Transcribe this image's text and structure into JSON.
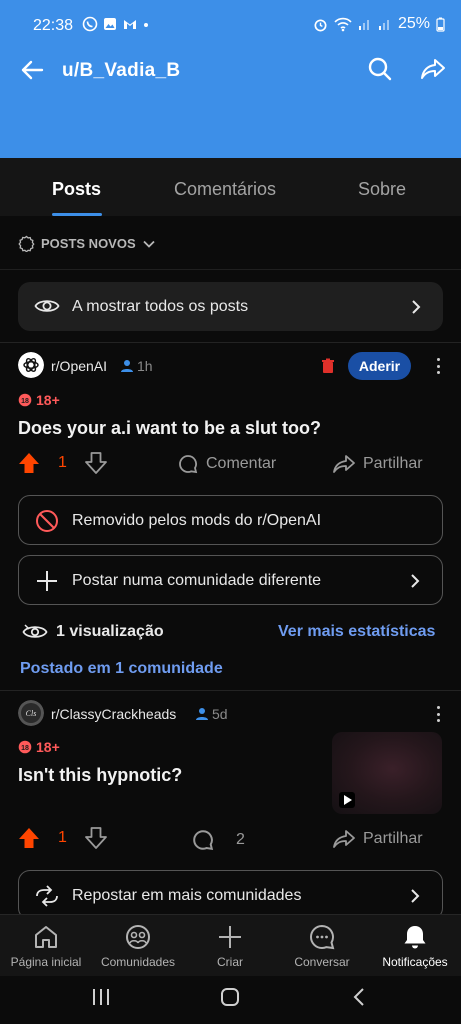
{
  "status": {
    "time": "22:38",
    "battery": "25%"
  },
  "header": {
    "title": "u/B_Vadia_B"
  },
  "tabs": [
    {
      "label": "Posts"
    },
    {
      "label": "Comentários"
    },
    {
      "label": "Sobre"
    }
  ],
  "sort": {
    "label": "POSTS NOVOS"
  },
  "filter": {
    "label": "A mostrar todos os posts"
  },
  "posts": [
    {
      "community": "r/OpenAI",
      "age": "1h",
      "nsfw": "18+",
      "title": "Does your a.i want to be a slut too?",
      "votes": "1",
      "comment_label": "Comentar",
      "share_label": "Partilhar",
      "join_label": "Aderir",
      "removed_label": "Removido pelos mods do r/OpenAI",
      "crosspost_label": "Postar numa comunidade diferente",
      "views": "1 visualização",
      "more_stats": "Ver mais estatísticas",
      "posted_in": "Postado em 1 comunidade"
    },
    {
      "community": "r/ClassyCrackheads",
      "age": "5d",
      "nsfw": "18+",
      "title": "Isn't this hypnotic?",
      "votes": "1",
      "comments": "2",
      "share_label": "Partilhar",
      "repost_label": "Repostar em mais comunidades"
    }
  ],
  "bottom_nav": [
    {
      "label": "Página inicial",
      "icon": "home-icon"
    },
    {
      "label": "Comunidades",
      "icon": "communities-icon"
    },
    {
      "label": "Criar",
      "icon": "plus-icon"
    },
    {
      "label": "Conversar",
      "icon": "chat-icon"
    },
    {
      "label": "Notificações",
      "icon": "bell-icon"
    }
  ],
  "colors": {
    "header": "#3d8fe8",
    "upvote": "#ff4500",
    "link": "#6f9cf0",
    "join": "#1a4fa5"
  }
}
